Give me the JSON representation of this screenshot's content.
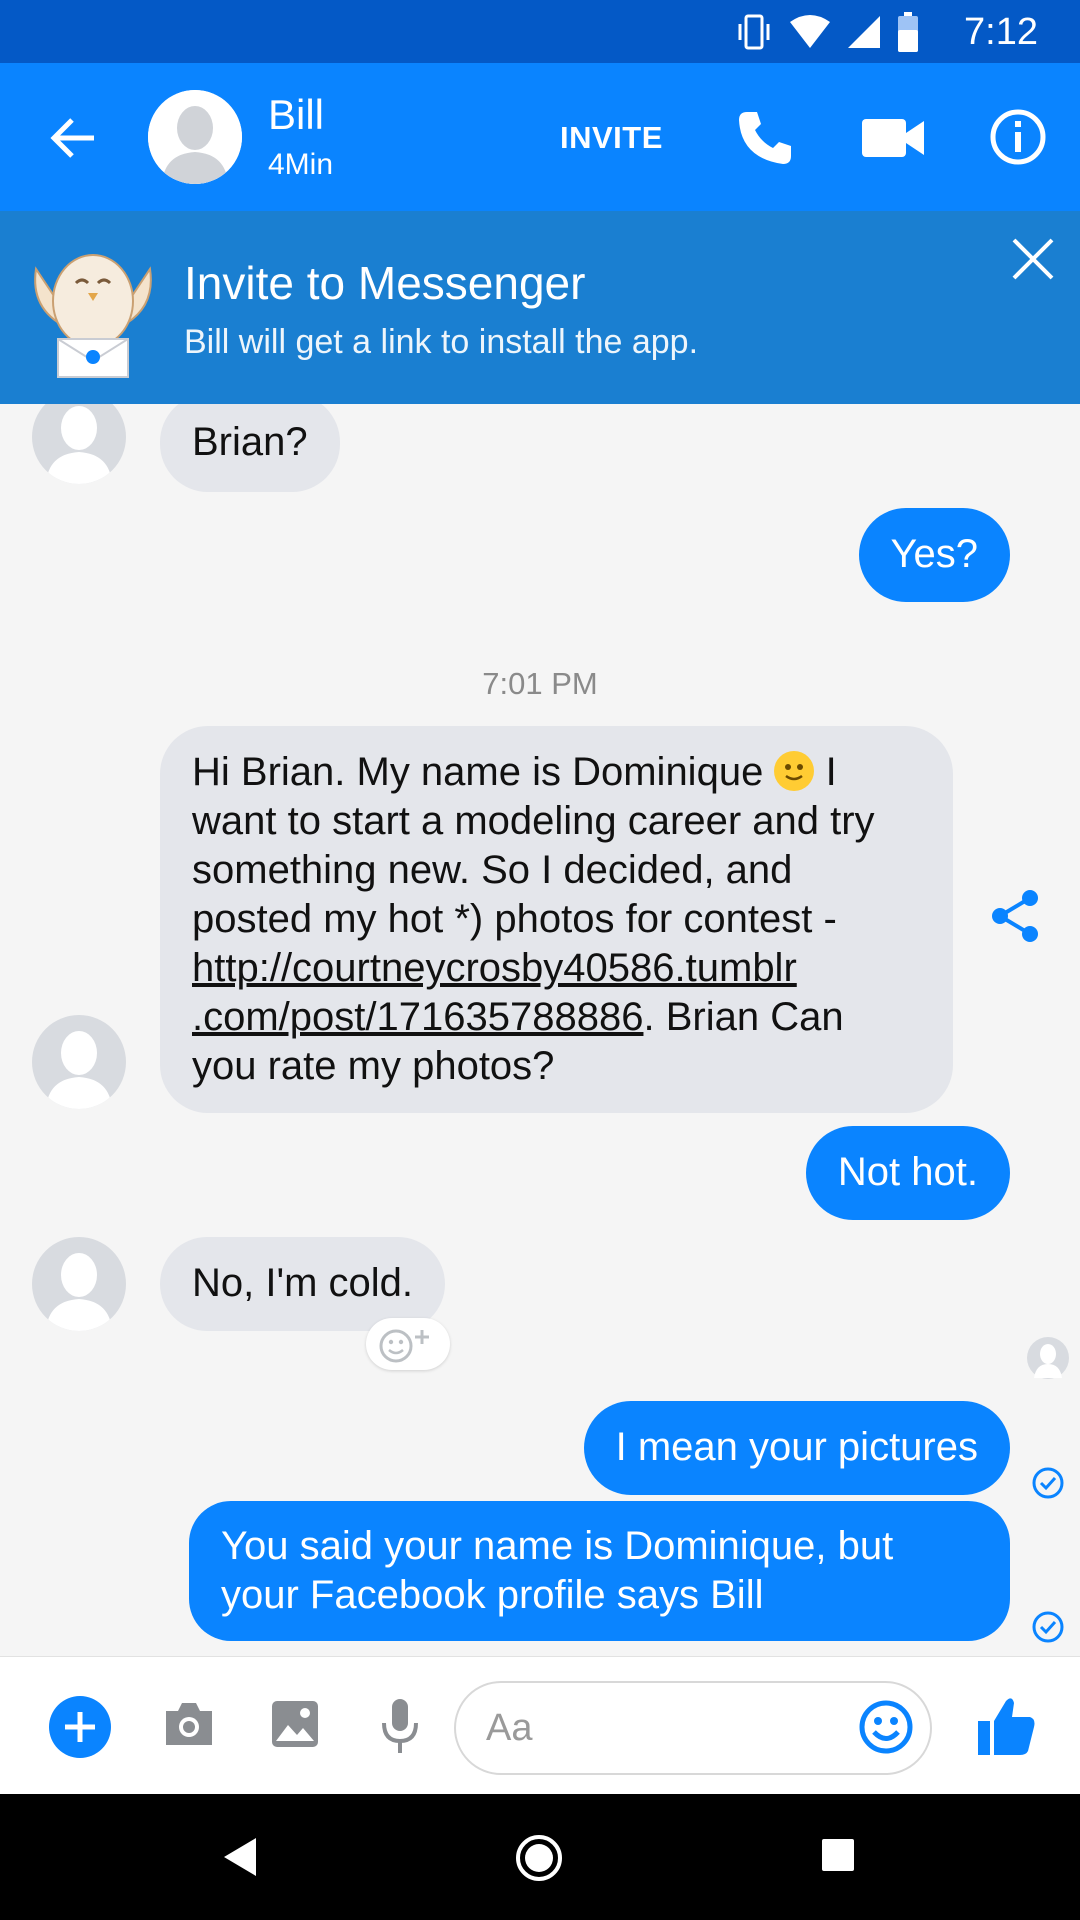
{
  "status_bar": {
    "time": "7:12"
  },
  "header": {
    "contact_name": "Bill",
    "contact_status": "4Min",
    "invite_label": "INVITE"
  },
  "banner": {
    "title": "Invite to Messenger",
    "subtitle": "Bill will get a link to install the app."
  },
  "chat": {
    "messages": [
      {
        "from": "them",
        "text": "Brian?"
      },
      {
        "from": "me",
        "text": "Yes?"
      },
      {
        "timestamp": "7:01 PM"
      },
      {
        "from": "them",
        "line1_a": "Hi Brian. My name is Dominique",
        "line1_b": "I",
        "line2": "want to start a modeling career and try",
        "line3": "something new. So I decided, and",
        "line4": "posted my hot *) photos for  contest -",
        "link_line1": "http://courtneycrosby40586.tumblr",
        "link_line2": ".com/post/171635788886",
        "after_link": ". Brian Can",
        "line7": "you rate my photos?"
      },
      {
        "from": "me",
        "text": "Not hot."
      },
      {
        "from": "them",
        "text": "No, I'm cold."
      },
      {
        "from": "me",
        "text": "I mean your pictures"
      },
      {
        "from": "me",
        "line1": "You said your name is Dominique, but",
        "line2": "your Facebook profile says Bill"
      }
    ]
  },
  "composer": {
    "placeholder": "Aa"
  },
  "colors": {
    "accent": "#0a84ff",
    "header": "#0a84ff",
    "status_bar": "#0459c6",
    "banner": "#1a7fd1",
    "incoming_bubble": "#e4e6eb"
  },
  "icons": [
    "back-arrow-icon",
    "phone-icon",
    "video-camera-icon",
    "info-icon",
    "close-icon",
    "share-icon",
    "add-reaction-icon",
    "seen-check-icon",
    "plus-icon",
    "camera-icon",
    "gallery-icon",
    "microphone-icon",
    "emoji-icon",
    "thumbs-up-icon"
  ]
}
